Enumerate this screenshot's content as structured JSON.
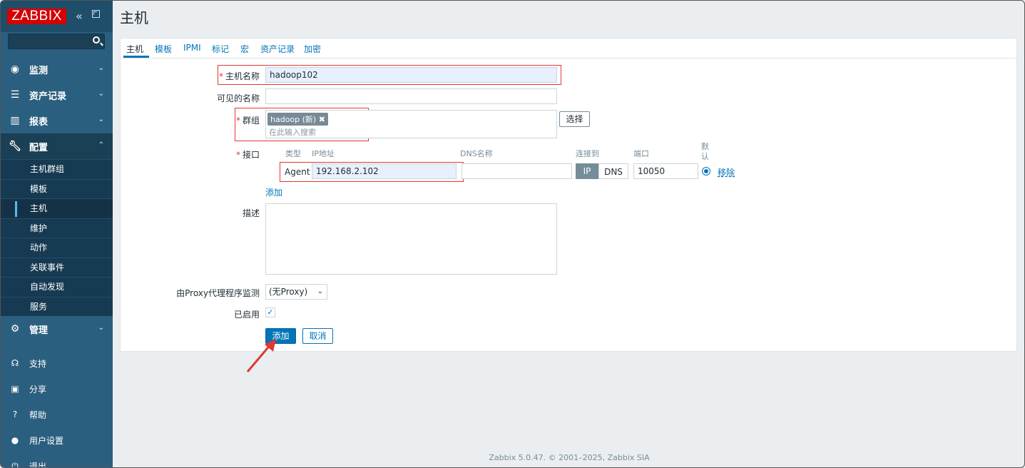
{
  "app": {
    "logo": "ZABBIX"
  },
  "sidebar": {
    "collapse": "«",
    "search_placeholder": "",
    "items": [
      {
        "label": "监测",
        "icon": "eye-icon"
      },
      {
        "label": "资产记录",
        "icon": "list-icon"
      },
      {
        "label": "报表",
        "icon": "bar-chart-icon"
      },
      {
        "label": "配置",
        "icon": "wrench-icon"
      },
      {
        "label": "管理",
        "icon": "gear-icon"
      }
    ],
    "submenu": [
      "主机群组",
      "模板",
      "主机",
      "维护",
      "动作",
      "关联事件",
      "自动发现",
      "服务"
    ],
    "bottom": [
      {
        "label": "支持",
        "icon": "headset-icon"
      },
      {
        "label": "分享",
        "icon": "share-icon"
      },
      {
        "label": "帮助",
        "icon": "help-icon"
      },
      {
        "label": "用户设置",
        "icon": "user-icon"
      },
      {
        "label": "退出",
        "icon": "power-icon"
      }
    ]
  },
  "page": {
    "title": "主机"
  },
  "tabs": [
    "主机",
    "模板",
    "IPMI",
    "标记",
    "宏",
    "资产记录",
    "加密"
  ],
  "form": {
    "host_name_label": "主机名称",
    "host_name_value": "hadoop102",
    "visible_name_label": "可见的名称",
    "visible_name_value": "",
    "groups_label": "群组",
    "group_tag": "hadoop (新)",
    "group_placeholder": "在此输入搜索",
    "select_button": "选择",
    "interfaces_label": "接口",
    "iface_headers": {
      "type": "类型",
      "ip": "IP地址",
      "dns": "DNS名称",
      "connect": "连接到",
      "port": "端口",
      "default": "默认"
    },
    "iface": {
      "type": "Agent",
      "ip": "192.168.2.102",
      "dns": "",
      "ip_btn": "IP",
      "dns_btn": "DNS",
      "port": "10050",
      "remove": "移除"
    },
    "add_link": "添加",
    "description_label": "描述",
    "proxy_label": "由Proxy代理程序监测",
    "proxy_value": "(无Proxy)",
    "enabled_label": "已启用",
    "add_button": "添加",
    "cancel_button": "取消"
  },
  "footer": "Zabbix 5.0.47. © 2001–2025, Zabbix SIA"
}
